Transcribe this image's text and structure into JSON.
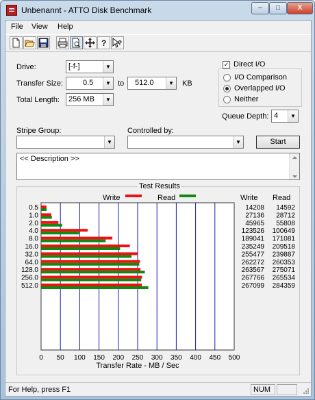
{
  "window": {
    "title": "Unbenannt - ATTO Disk Benchmark",
    "minimize": "–",
    "maximize": "□",
    "close": "X"
  },
  "menu": [
    "File",
    "View",
    "Help"
  ],
  "toolbar": [
    "new-icon",
    "open-icon",
    "save-icon",
    "print-icon",
    "print-preview-icon",
    "move-icon",
    "about-icon",
    "context-help-icon"
  ],
  "form": {
    "drive_label": "Drive:",
    "drive_value": "[-f-]",
    "transfer_size_label": "Transfer Size:",
    "transfer_from": "0.5",
    "to_label": "to",
    "transfer_to": "512.0",
    "kb_label": "KB",
    "total_length_label": "Total Length:",
    "total_length_value": "256 MB",
    "direct_io_label": "Direct I/O",
    "io_comparison_label": "I/O Comparison",
    "overlapped_io_label": "Overlapped I/O",
    "neither_label": "Neither",
    "queue_depth_label": "Queue Depth:",
    "queue_depth_value": "4",
    "stripe_group_label": "Stripe Group:",
    "controlled_by_label": "Controlled by:",
    "start_label": "Start",
    "description_text": "<< Description >>"
  },
  "results": {
    "caption": "Test Results",
    "write_legend": "Write",
    "read_legend": "Read",
    "write_header": "Write",
    "read_header": "Read"
  },
  "colors": {
    "write": "#ee1111",
    "read": "#118811",
    "grid": "#1a1aaa"
  },
  "chart_data": {
    "type": "bar",
    "orientation": "horizontal",
    "categories": [
      "0.5",
      "1.0",
      "2.0",
      "4.0",
      "8.0",
      "16.0",
      "32.0",
      "64.0",
      "128.0",
      "256.0",
      "512.0"
    ],
    "series": [
      {
        "name": "Write",
        "values": [
          14208,
          27136,
          45965,
          123526,
          189041,
          235249,
          255477,
          262272,
          263567,
          267766,
          267099
        ]
      },
      {
        "name": "Read",
        "values": [
          14592,
          28712,
          55808,
          100649,
          171081,
          209518,
          239887,
          260353,
          275071,
          265534,
          284359
        ]
      }
    ],
    "xlabel": "Transfer Rate - MB / Sec",
    "xticks": [
      0,
      50,
      100,
      150,
      200,
      250,
      300,
      350,
      400,
      450,
      500
    ],
    "xlim": [
      0,
      500
    ],
    "grid": true,
    "legend": "top"
  },
  "status": {
    "message": "For Help, press F1",
    "num": "NUM"
  }
}
